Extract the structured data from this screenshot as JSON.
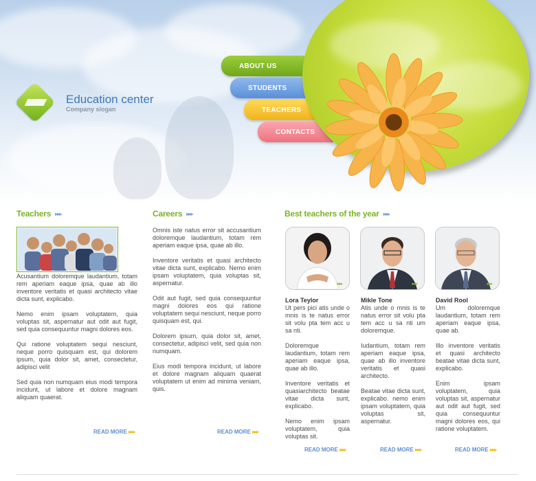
{
  "logo": {
    "title": "Education center",
    "slogan": "Company slogan"
  },
  "nav": [
    {
      "label": "ABOUT US",
      "color": "#7ab51f"
    },
    {
      "label": "STUDENTS",
      "color": "#6a9fe0"
    },
    {
      "label": "TEACHERS",
      "color": "#f4c12a"
    },
    {
      "label": "CONTACTS",
      "color": "#f07c88"
    }
  ],
  "teachers": {
    "title": "Teachers",
    "paragraphs": [
      "Acusantium doloremque laudantium, totam rem aperiam eaque ipsa, quae ab illo inventore veritatis et quasi architecto vitae dicta sunt, explicabo.",
      "Nemo enim ipsam voluptatem, quia voluptas sit, aspernatur aut odit aut fugit, sed quia consequuntur magni dolores eos.",
      "Qui ratione voluptatem sequi nesciunt, neque porro quisquam est, qui dolorem ipsum, quia dolor sit, amet, consectetur, adipisci velit",
      "Sed quia non numquam eius modi tempora incidunt, ut labore et dolore magnam aliquam quaerat."
    ],
    "read_more": "READ MORE"
  },
  "careers": {
    "title": "Careers",
    "paragraphs": [
      "Omnis iste natus error sit accusantium doloremque laudantium, totam rem aperiam eaque ipsa, quae ab illo.",
      "Inventore veritatis et quasi architecto vitae dicta sunt, explicabo. Nemo enim ipsam voluptatem, quia voluptas sit, aspernatur.",
      "Odit aut fugit, sed quia consequuntur magni dolores eos qui ratione voluptatem sequi nesciunt, neque porro quisquam est, qui.",
      "Dolorem ipsum, quia dolor sit, amet, consectetur, adipisci velit, sed quia non numquam.",
      "Eius modi tempora incidunt, ut labore et dolore magnam aliquam quaerat voluptatem ut enim ad minima veniam, quis."
    ],
    "read_more": "READ MORE"
  },
  "best": {
    "title": "Best teachers of the year",
    "people": [
      {
        "name": "Lora Teylor",
        "paragraphs": [
          "Ut pers pici atis unde o mnis is te natus error sit volu pta tem acc u sa nti.",
          "Doloremque laudantium, totam rem aperiam eaque ipsa, quae ab illo.",
          "Inventore veritatis et quasiarchitecto beatae vitae dicta sunt, explicabo.",
          "Nemo enim ipsam voluptatem, quia voluptas sit."
        ],
        "read_more": "READ MORE"
      },
      {
        "name": "Mikle Tone",
        "paragraphs": [
          "Atis unde o mnis is te natus error sit volu pta tem acc u sa nti um doloremque.",
          "Iudantium, totam rem aperiam eaque ipsa, quae ab illo inventore veritatis et quasi architecto.",
          "Beatae vitae dicta sunt, explicabo. nemo enim ipsam voluptatem, quia voluptas sit, aspernatur."
        ],
        "read_more": "READ MORE"
      },
      {
        "name": "David Rool",
        "paragraphs": [
          "Um doloremque laudantium, totam rem aperiam eaque ipsa, quae ab.",
          "Illo inventore veritatis et quasi architecto beatae vitae dicta sunt, explicabo.",
          "Enim ipsam voluptatem, quia voluptas sit, aspernatur aut odit aut fugit, sed quia consequuntur magni dolores eos, qui ratione voluptatem."
        ],
        "read_more": "READ MORE"
      }
    ]
  }
}
